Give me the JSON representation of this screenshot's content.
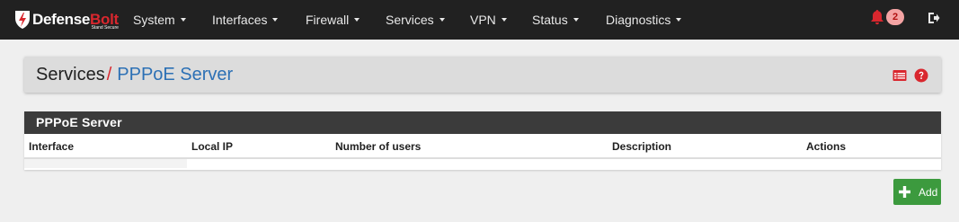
{
  "brand": {
    "name_main": "Defense",
    "name_accent": "Bolt",
    "tagline": "Stand Secure"
  },
  "nav": {
    "items": [
      {
        "label": "System"
      },
      {
        "label": "Interfaces"
      },
      {
        "label": "Firewall"
      },
      {
        "label": "Services"
      },
      {
        "label": "VPN"
      },
      {
        "label": "Status"
      },
      {
        "label": "Diagnostics"
      }
    ],
    "notifications_count": "2"
  },
  "breadcrumb": {
    "root": "Services",
    "separator": "/",
    "current": "PPPoE Server"
  },
  "panel": {
    "title": "PPPoE Server",
    "columns": [
      "Interface",
      "Local IP",
      "Number of users",
      "Description",
      "Actions"
    ],
    "rows": []
  },
  "actions": {
    "add_label": "Add"
  },
  "colors": {
    "navbar": "#212121",
    "accent_red": "#d9272e",
    "link_blue": "#2c70b5",
    "success_green": "#3c9a3e"
  }
}
